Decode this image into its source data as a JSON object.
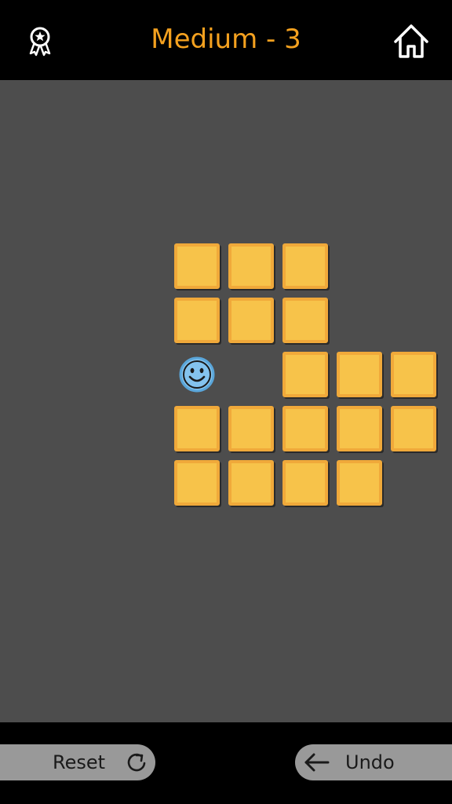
{
  "header": {
    "title": "Medium - 3",
    "left_icon": "award-ribbon-icon",
    "right_icon": "home-icon"
  },
  "board": {
    "columns": 5,
    "rows": 5,
    "tile_cells": [
      [
        0,
        0
      ],
      [
        0,
        1
      ],
      [
        0,
        2
      ],
      [
        1,
        0
      ],
      [
        1,
        1
      ],
      [
        1,
        2
      ],
      [
        2,
        2
      ],
      [
        2,
        3
      ],
      [
        2,
        4
      ],
      [
        3,
        0
      ],
      [
        3,
        1
      ],
      [
        3,
        2
      ],
      [
        3,
        3
      ],
      [
        3,
        4
      ],
      [
        4,
        0
      ],
      [
        4,
        1
      ],
      [
        4,
        2
      ],
      [
        4,
        3
      ]
    ],
    "player_cell": [
      2,
      0
    ],
    "player_icon": "smiley-face-icon"
  },
  "footer": {
    "reset_label": "Reset",
    "reset_icon": "refresh-icon",
    "undo_label": "Undo",
    "undo_icon": "arrow-left-icon"
  },
  "colors": {
    "title": "#f4a11f",
    "tile_fill": "#f7c34a",
    "tile_border": "#f0a93a",
    "board_bg": "#4d4d4d",
    "player": "#84c3ee",
    "button_bg": "#999999"
  }
}
